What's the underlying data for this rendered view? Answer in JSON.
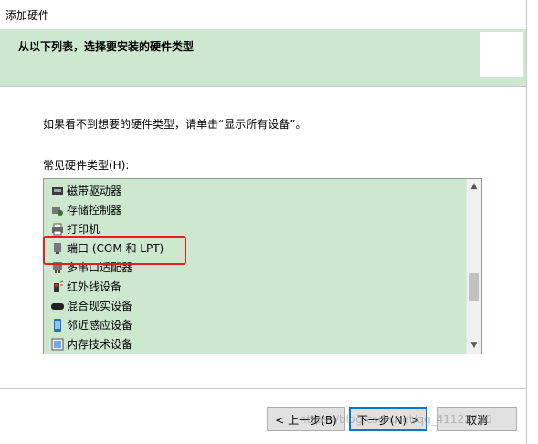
{
  "window": {
    "title": "添加硬件"
  },
  "header": {
    "heading": "从以下列表，选择要安装的硬件类型"
  },
  "hint": "如果看不到想要的硬件类型，请单击“显示所有设备”。",
  "list": {
    "label": "常见硬件类型(H):",
    "items": [
      {
        "label": "磁带驱动器",
        "icon": "tape-drive-icon"
      },
      {
        "label": "存储控制器",
        "icon": "storage-controller-icon"
      },
      {
        "label": "打印机",
        "icon": "printer-icon"
      },
      {
        "label": "端口 (COM 和 LPT)",
        "icon": "port-icon"
      },
      {
        "label": "多串口适配器",
        "icon": "multiport-serial-icon"
      },
      {
        "label": "红外线设备",
        "icon": "infrared-icon"
      },
      {
        "label": "混合现实设备",
        "icon": "mixed-reality-icon"
      },
      {
        "label": "邻近感应设备",
        "icon": "proximity-icon"
      },
      {
        "label": "内存技术设备",
        "icon": "memory-tech-icon"
      }
    ]
  },
  "buttons": {
    "back": "< 上一步(B)",
    "next": "下一步(N) >",
    "cancel": "取消"
  },
  "watermark": "https://blog.csdn.net/qq_41122796",
  "colors": {
    "panel_bg": "#cde8cf",
    "highlight_box": "#e02020",
    "default_button_border": "#0078d7"
  }
}
